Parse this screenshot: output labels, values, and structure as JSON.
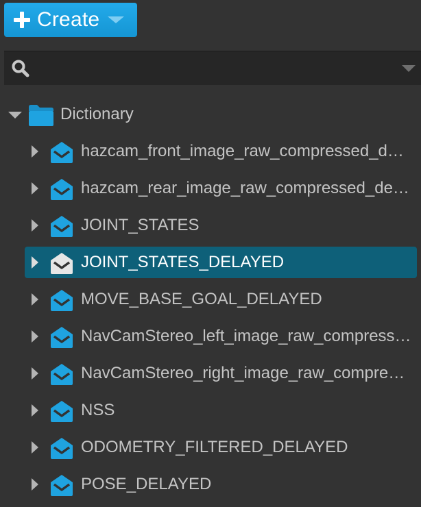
{
  "toolbar": {
    "create_label": "Create",
    "accent_color": "#1ba1e2"
  },
  "search": {
    "value": "",
    "placeholder": ""
  },
  "tree": {
    "root": {
      "label": "Dictionary",
      "expanded": true,
      "icon": "folder-icon"
    },
    "items": [
      {
        "label": "hazcam_front_image_raw_compressed_delayed",
        "selected": false,
        "icon": "envelope-icon"
      },
      {
        "label": "hazcam_rear_image_raw_compressed_delayed",
        "selected": false,
        "icon": "envelope-icon"
      },
      {
        "label": "JOINT_STATES",
        "selected": false,
        "icon": "envelope-icon"
      },
      {
        "label": "JOINT_STATES_DELAYED",
        "selected": true,
        "icon": "envelope-icon"
      },
      {
        "label": "MOVE_BASE_GOAL_DELAYED",
        "selected": false,
        "icon": "envelope-icon"
      },
      {
        "label": "NavCamStereo_left_image_raw_compressed_delayed",
        "selected": false,
        "icon": "envelope-icon"
      },
      {
        "label": "NavCamStereo_right_image_raw_compressed_delayed",
        "selected": false,
        "icon": "envelope-icon"
      },
      {
        "label": "NSS",
        "selected": false,
        "icon": "envelope-icon"
      },
      {
        "label": "ODOMETRY_FILTERED_DELAYED",
        "selected": false,
        "icon": "envelope-icon"
      },
      {
        "label": "POSE_DELAYED",
        "selected": false,
        "icon": "envelope-icon"
      }
    ],
    "selected_color": "#0e6079",
    "icon_color": "#1fa3e0"
  }
}
